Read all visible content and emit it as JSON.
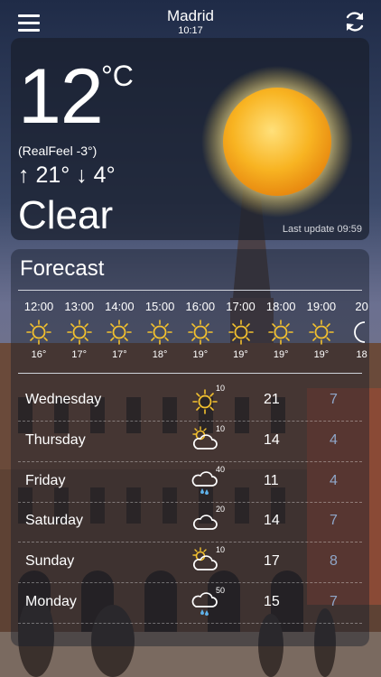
{
  "header": {
    "city": "Madrid",
    "time": "10:17"
  },
  "current": {
    "temperature": "12",
    "unit": "°C",
    "realfeel": "(RealFeel -3°)",
    "high": "↑ 21°",
    "low": "↓ 4°",
    "condition": "Clear",
    "last_update": "Last update 09:59",
    "icon": "sun-icon"
  },
  "forecast": {
    "title": "Forecast",
    "hourly": [
      {
        "time": "12:00",
        "temp": "16°",
        "icon": "sun-icon"
      },
      {
        "time": "13:00",
        "temp": "17°",
        "icon": "sun-icon"
      },
      {
        "time": "14:00",
        "temp": "17°",
        "icon": "sun-icon"
      },
      {
        "time": "15:00",
        "temp": "18°",
        "icon": "sun-icon"
      },
      {
        "time": "16:00",
        "temp": "19°",
        "icon": "sun-icon"
      },
      {
        "time": "17:00",
        "temp": "19°",
        "icon": "sun-icon"
      },
      {
        "time": "18:00",
        "temp": "19°",
        "icon": "sun-icon"
      },
      {
        "time": "19:00",
        "temp": "19°",
        "icon": "sun-icon"
      },
      {
        "time": "20",
        "temp": "18",
        "icon": "moon-icon"
      }
    ],
    "daily": [
      {
        "day": "Wednesday",
        "precip": "10",
        "high": "21",
        "low": "7",
        "icon": "sun-icon"
      },
      {
        "day": "Thursday",
        "precip": "10",
        "high": "14",
        "low": "4",
        "icon": "partly-cloudy-icon"
      },
      {
        "day": "Friday",
        "precip": "40",
        "high": "11",
        "low": "4",
        "icon": "rain-cloud-icon"
      },
      {
        "day": "Saturday",
        "precip": "20",
        "high": "14",
        "low": "7",
        "icon": "cloud-icon"
      },
      {
        "day": "Sunday",
        "precip": "10",
        "high": "17",
        "low": "8",
        "icon": "partly-cloudy-icon"
      },
      {
        "day": "Monday",
        "precip": "50",
        "high": "15",
        "low": "7",
        "icon": "rain-cloud-icon"
      }
    ]
  },
  "colors": {
    "low_temp": "#8fa6c8",
    "sun": "#f7a81a"
  }
}
